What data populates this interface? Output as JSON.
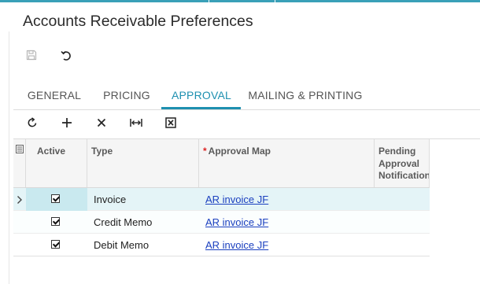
{
  "page": {
    "title": "Accounts Receivable Preferences"
  },
  "toolbar": {
    "save_icon": "save-icon",
    "undo_icon": "undo-icon"
  },
  "tabs": [
    {
      "label": "GENERAL",
      "active": false
    },
    {
      "label": "PRICING",
      "active": false
    },
    {
      "label": "APPROVAL",
      "active": true
    },
    {
      "label": "MAILING & PRINTING",
      "active": false
    }
  ],
  "grid_toolbar": {
    "buttons": [
      "refresh-icon",
      "add-icon",
      "delete-icon",
      "fit-columns-icon",
      "export-excel-icon"
    ]
  },
  "grid": {
    "columns": {
      "active": "Active",
      "type": "Type",
      "approval_map_required": "*",
      "approval_map": "Approval Map",
      "pending": "Pending Approval Notification"
    },
    "rows": [
      {
        "active": true,
        "type": "Invoice",
        "approval_map": "AR invoice JF",
        "selected": true
      },
      {
        "active": true,
        "type": "Credit Memo",
        "approval_map": "AR invoice JF",
        "selected": false
      },
      {
        "active": true,
        "type": "Debit Memo",
        "approval_map": "AR invoice JF",
        "selected": false
      }
    ]
  },
  "colors": {
    "accent": "#1e90b0",
    "selected_row": "#e4f4f7",
    "link": "#1a3fbf",
    "required": "#dd2222"
  }
}
